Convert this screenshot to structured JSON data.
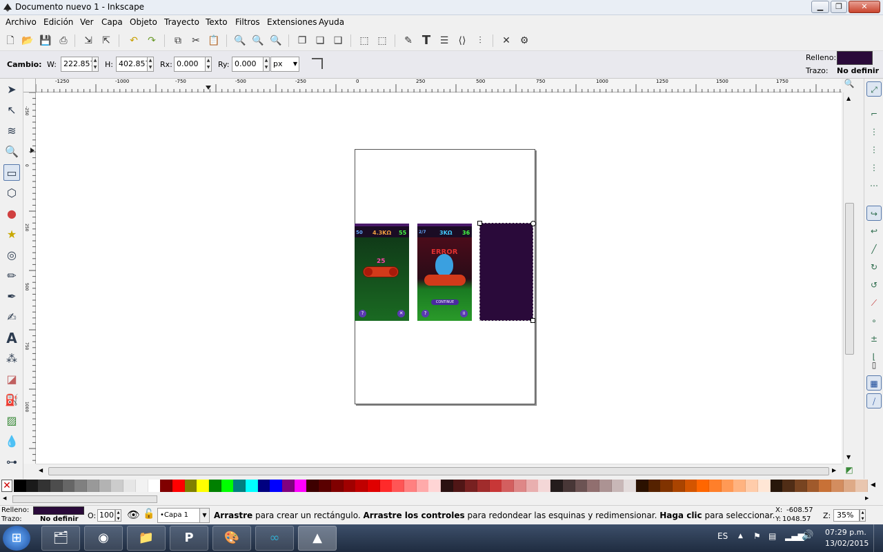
{
  "window": {
    "title": "Documento nuevo 1 - Inkscape",
    "minimize": "▁",
    "maximize": "❐",
    "close": "✕"
  },
  "menu": [
    "Archivo",
    "Edición",
    "Ver",
    "Capa",
    "Objeto",
    "Trayecto",
    "Texto",
    "Filtros",
    "Extensiones",
    "Ayuda"
  ],
  "controls": {
    "cambio": "Cambio:",
    "w_label": "W:",
    "w_value": "222.857",
    "h_label": "H:",
    "h_value": "402.857",
    "rx_label": "Rx:",
    "rx_value": "0.000",
    "ry_label": "Ry:",
    "ry_value": "0.000",
    "unit": "px"
  },
  "style_indicator": {
    "fill_label": "Relleno:",
    "stroke_label": "Trazo:",
    "stroke_value": "No definir",
    "fill_color": "#2a0a3a"
  },
  "ruler_labels": [
    "-1250",
    "-1000",
    "-750",
    "-500",
    "-250",
    "0",
    "250",
    "500",
    "750",
    "1000",
    "1250",
    "1500",
    "1750"
  ],
  "vruler_labels": [
    "-250",
    "0",
    "250",
    "500",
    "750",
    "1000"
  ],
  "screenshots": {
    "shot1": {
      "top_left": "50",
      "value": "4.3KΩ",
      "top_right": "55",
      "number": "25",
      "help": "?",
      "close": "✕"
    },
    "shot2": {
      "top_left": "2/7",
      "value": "3KΩ",
      "top_right": "36",
      "error": "ERROR",
      "continue": "CONTINUE",
      "help": "?",
      "pause": "II"
    }
  },
  "selected_rect_color": "#2a0a3a",
  "palette": [
    "#000000",
    "#1a1a1a",
    "#333333",
    "#4d4d4d",
    "#666666",
    "#808080",
    "#999999",
    "#b3b3b3",
    "#cccccc",
    "#e6e6e6",
    "#f2f2f2",
    "#ffffff",
    "#800000",
    "#ff0000",
    "#808000",
    "#ffff00",
    "#008000",
    "#00ff00",
    "#008080",
    "#00ffff",
    "#000080",
    "#0000ff",
    "#800080",
    "#ff00ff",
    "#3d0000",
    "#5a0000",
    "#800000",
    "#a00000",
    "#c00000",
    "#e00000",
    "#ff2a2a",
    "#ff5555",
    "#ff8080",
    "#ffaaaa",
    "#ffd5d5",
    "#2b1111",
    "#501616",
    "#782121",
    "#a02c2c",
    "#c83737",
    "#d35f5f",
    "#de8787",
    "#e9afaf",
    "#f4d7d7",
    "#241c1c",
    "#483737",
    "#6c5353",
    "#916f6f",
    "#ac9393",
    "#c8b7b7",
    "#e3dbdb",
    "#2b1100",
    "#552200",
    "#803300",
    "#aa4400",
    "#d45500",
    "#ff6600",
    "#ff7f2a",
    "#ff9955",
    "#ffb380",
    "#ffccaa",
    "#ffe6d5",
    "#28170b",
    "#502d16",
    "#784421",
    "#a05a2c",
    "#c87137",
    "#d38d5f",
    "#deaa87",
    "#e9c6af"
  ],
  "status": {
    "fill_label": "Relleno:",
    "stroke_label": "Trazo:",
    "stroke_value": "No definir",
    "opacity_label": "O:",
    "opacity_value": "100",
    "layer": "•Capa 1",
    "msg_bold1": "Arrastre",
    "msg_1": " para crear un rectángulo. ",
    "msg_bold2": "Arrastre los controles",
    "msg_2": " para redondear las esquinas y redimensionar. ",
    "msg_bold3": "Haga clic",
    "msg_3": " para seleccionar.",
    "x_label": "X:",
    "x_value": "-608.57",
    "y_label": "Y:",
    "y_value": "1048.57",
    "zoom_label": "Z:",
    "zoom_value": "35%"
  },
  "taskbar": {
    "lang": "ES",
    "time": "07:29 p.m.",
    "date": "13/02/2015",
    "apps": [
      "explorer-icon",
      "chrome-icon",
      "folder-icon",
      "p-app-icon",
      "paint-icon",
      "arduino-icon",
      "inkscape-icon"
    ],
    "p_letter": "P"
  }
}
